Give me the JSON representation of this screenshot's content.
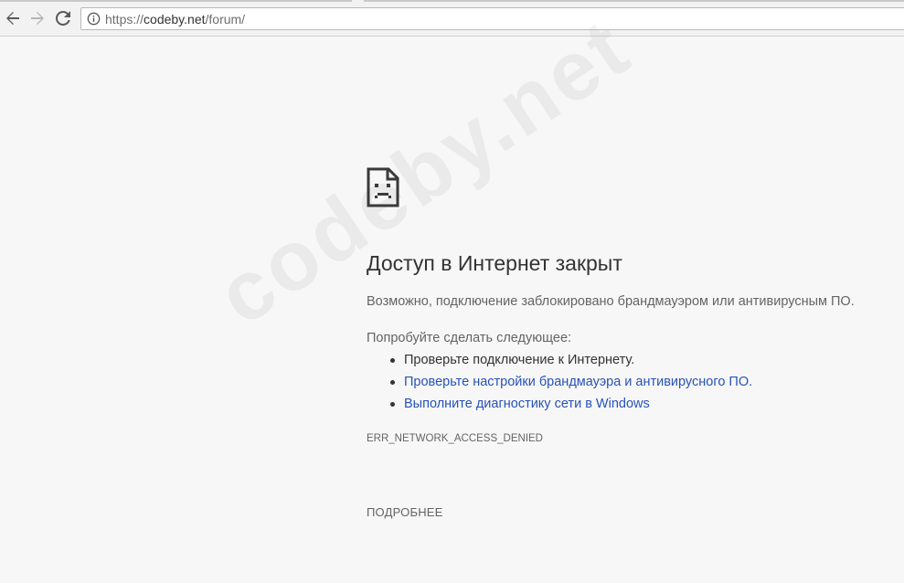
{
  "browser": {
    "address_bar": {
      "scheme": "https://",
      "host": "codeby.net",
      "path": "/forum/"
    },
    "icons": {
      "back": "back-arrow-icon",
      "forward": "forward-arrow-icon",
      "reload": "reload-icon",
      "site_info": "info-icon"
    }
  },
  "error_page": {
    "icon": "sad-page-icon",
    "title": "Доступ в Интернет закрыт",
    "description": "Возможно, подключение заблокировано брандмауэром или антивирусным ПО.",
    "try_heading": "Попробуйте сделать следующее:",
    "suggestions": [
      {
        "text": "Проверьте подключение к Интернету.",
        "link": false
      },
      {
        "text": "Проверьте настройки брандмауэра и антивирусного ПО.",
        "link": true
      },
      {
        "text": "Выполните диагностику сети в Windows",
        "link": true
      }
    ],
    "error_code": "ERR_NETWORK_ACCESS_DENIED",
    "details_label": "ПОДРОБНЕЕ"
  },
  "watermark": "codeby.net",
  "colors": {
    "link": "#2753b7",
    "title": "#333333",
    "secondary_text": "#646464",
    "background": "#f7f7f7"
  }
}
